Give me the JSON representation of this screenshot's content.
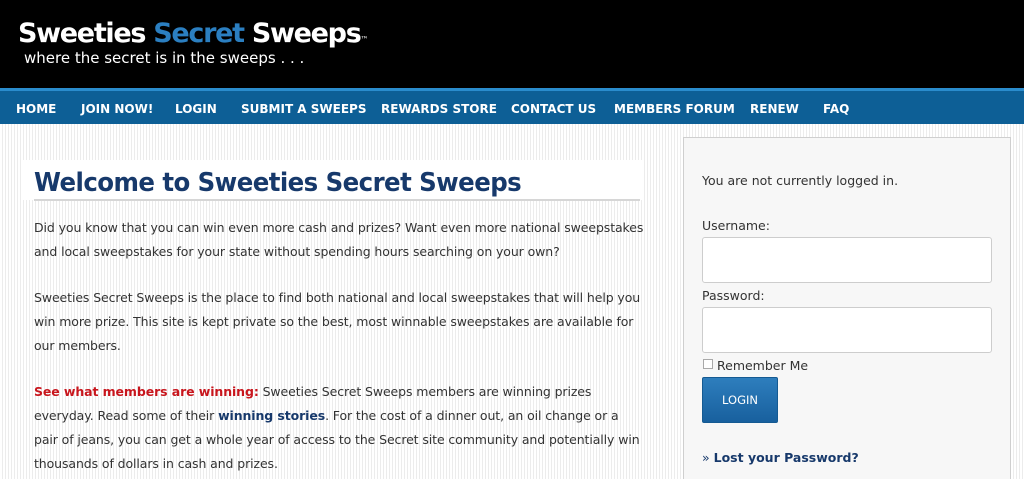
{
  "header": {
    "logo_part1": "Sweeties ",
    "logo_part2": "Secret",
    "logo_part3": " Sweeps",
    "logo_tm": "™",
    "tagline": "where the secret is in the sweeps . . ."
  },
  "nav": {
    "items": [
      "HOME",
      "JOIN NOW!",
      "LOGIN",
      "SUBMIT A SWEEPS",
      "REWARDS STORE",
      "CONTACT US",
      "MEMBERS FORUM",
      "RENEW",
      "FAQ"
    ]
  },
  "main": {
    "title": "Welcome to Sweeties Secret Sweeps",
    "para1": "Did you know that you can win even more cash and prizes? Want even more national sweepstakes and local sweepstakes for your state without spending hours searching on your own?",
    "para2": "Sweeties Secret Sweeps is the place to find both national and local sweepstakes that will help you win more prize. This site is kept private so the best, most winnable sweepstakes are available for our members.",
    "para3_lead": "See what members are winning:",
    "para3_a": " Sweeties Secret Sweeps members are winning prizes everyday. Read some of their ",
    "para3_link": "winning stories",
    "para3_b": ". For the cost of a dinner out, an oil change or a pair of jeans, you can get a whole year of access to the Secret site community and potentially win thousands of dollars in cash and prizes."
  },
  "sidebar": {
    "status": "You are not currently logged in.",
    "username_label": "Username:",
    "username_value": "",
    "password_label": "Password:",
    "password_value": "",
    "remember_label": "Remember Me",
    "login_button": "LOGIN",
    "lost_prefix": "» ",
    "lost_link": "Lost your Password?"
  },
  "colors": {
    "header_bg": "#000000",
    "logo_accent": "#2b7fc1",
    "nav_bg": "#0d5f96",
    "title": "#17396b",
    "highlight_red": "#c8161d",
    "button": "#1f6eae"
  }
}
